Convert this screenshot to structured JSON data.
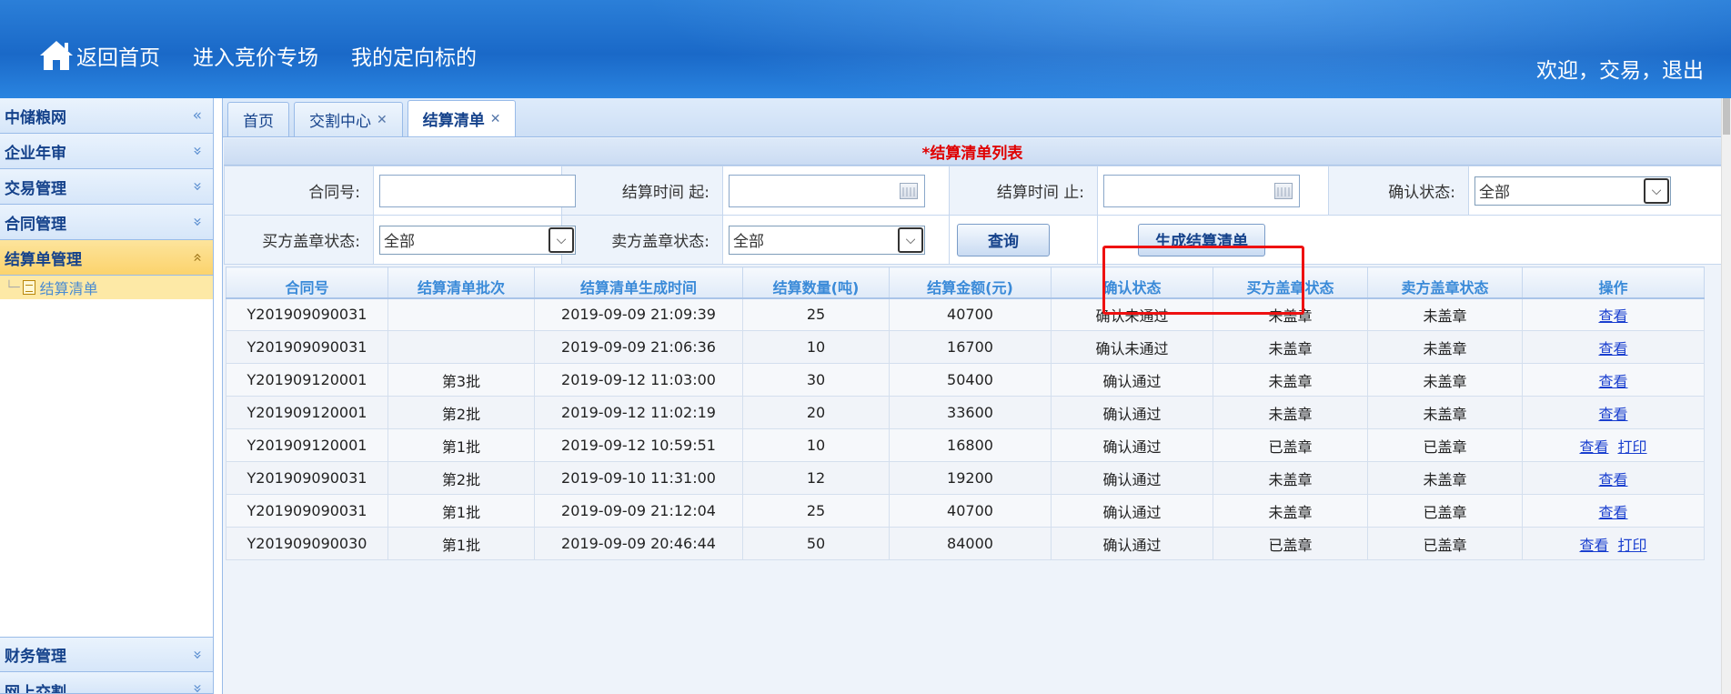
{
  "header": {
    "home_label": "返回首页",
    "nav": [
      "进入竞价专场",
      "我的定向标的"
    ],
    "welcome": "欢迎",
    "sep1": "，",
    "user": "交易",
    "sep2": "，",
    "logout": "退出"
  },
  "sidebar": {
    "top_items": [
      {
        "label": "中储粮网",
        "chev": "«"
      },
      {
        "label": "企业年审",
        "chev": "»"
      },
      {
        "label": "交易管理",
        "chev": "»"
      },
      {
        "label": "合同管理",
        "chev": "»"
      }
    ],
    "active_item": {
      "label": "结算单管理",
      "chev": "»"
    },
    "sub_item": "结算清单",
    "bottom_items": [
      {
        "label": "财务管理",
        "chev": "»"
      },
      {
        "label": "网上交割",
        "chev": "»"
      }
    ]
  },
  "tabs": [
    {
      "label": "首页",
      "closable": false
    },
    {
      "label": "交割中心",
      "closable": true
    },
    {
      "label": "结算清单",
      "closable": true,
      "active": true
    }
  ],
  "panel": {
    "title": "*结算清单列表"
  },
  "filters": {
    "contract_no_label": "合同号:",
    "contract_no_value": "",
    "start_time_label": "结算时间 起:",
    "start_time_value": "",
    "end_time_label": "结算时间 止:",
    "end_time_value": "",
    "confirm_status_label": "确认状态:",
    "confirm_status_value": "全部",
    "buyer_seal_label": "买方盖章状态:",
    "buyer_seal_value": "全部",
    "seller_seal_label": "卖方盖章状态:",
    "seller_seal_value": "全部",
    "query_button": "查询",
    "generate_button": "生成结算清单"
  },
  "table": {
    "columns": [
      "合同号",
      "结算清单批次",
      "结算清单生成时间",
      "结算数量(吨)",
      "结算金额(元)",
      "确认状态",
      "买方盖章状态",
      "卖方盖章状态",
      "操作"
    ],
    "rows": [
      {
        "contract": "Y201909090031",
        "batch": "",
        "time": "2019-09-09 21:09:39",
        "qty": "25",
        "amount": "40700",
        "confirm": "确认未通过",
        "buyer": "未盖章",
        "seller": "未盖章",
        "actions": [
          "查看"
        ]
      },
      {
        "contract": "Y201909090031",
        "batch": "",
        "time": "2019-09-09 21:06:36",
        "qty": "10",
        "amount": "16700",
        "confirm": "确认未通过",
        "buyer": "未盖章",
        "seller": "未盖章",
        "actions": [
          "查看"
        ]
      },
      {
        "contract": "Y201909120001",
        "batch": "第3批",
        "time": "2019-09-12 11:03:00",
        "qty": "30",
        "amount": "50400",
        "confirm": "确认通过",
        "buyer": "未盖章",
        "seller": "未盖章",
        "actions": [
          "查看"
        ]
      },
      {
        "contract": "Y201909120001",
        "batch": "第2批",
        "time": "2019-09-12 11:02:19",
        "qty": "20",
        "amount": "33600",
        "confirm": "确认通过",
        "buyer": "未盖章",
        "seller": "未盖章",
        "actions": [
          "查看"
        ]
      },
      {
        "contract": "Y201909120001",
        "batch": "第1批",
        "time": "2019-09-12 10:59:51",
        "qty": "10",
        "amount": "16800",
        "confirm": "确认通过",
        "buyer": "已盖章",
        "seller": "已盖章",
        "actions": [
          "查看",
          "打印"
        ]
      },
      {
        "contract": "Y201909090031",
        "batch": "第2批",
        "time": "2019-09-10 11:31:00",
        "qty": "12",
        "amount": "19200",
        "confirm": "确认通过",
        "buyer": "未盖章",
        "seller": "未盖章",
        "actions": [
          "查看"
        ]
      },
      {
        "contract": "Y201909090031",
        "batch": "第1批",
        "time": "2019-09-09 21:12:04",
        "qty": "25",
        "amount": "40700",
        "confirm": "确认通过",
        "buyer": "未盖章",
        "seller": "已盖章",
        "actions": [
          "查看"
        ]
      },
      {
        "contract": "Y201909090030",
        "batch": "第1批",
        "time": "2019-09-09 20:46:44",
        "qty": "50",
        "amount": "84000",
        "confirm": "确认通过",
        "buyer": "已盖章",
        "seller": "已盖章",
        "actions": [
          "查看",
          "打印"
        ]
      }
    ]
  },
  "colors": {
    "header_blue": "#1a69c8",
    "accent_red": "#e00000",
    "active_yellow": "#fbd36c",
    "link_blue": "#1a3fcf"
  }
}
